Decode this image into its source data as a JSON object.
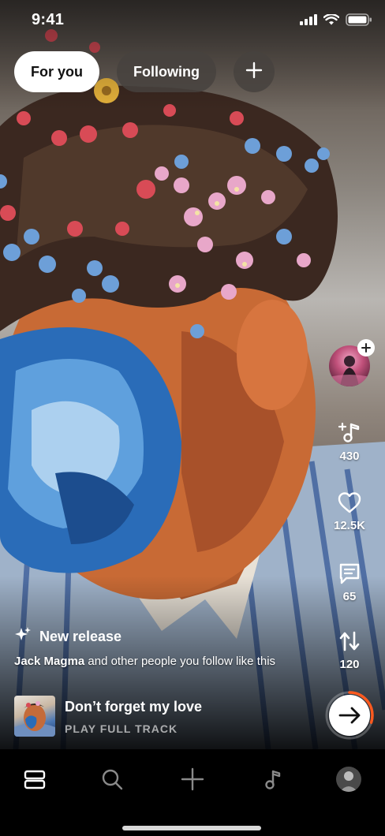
{
  "status_bar": {
    "time": "9:41"
  },
  "tabs": {
    "for_you": "For you",
    "following": "Following",
    "add_icon": "plus-icon"
  },
  "rail": {
    "avatar_icon": "artist-avatar",
    "add_track": {
      "icon": "music-plus-icon",
      "count": "430"
    },
    "like": {
      "icon": "heart-icon",
      "count": "12.5K"
    },
    "comment": {
      "icon": "comment-icon",
      "count": "65"
    },
    "repost": {
      "icon": "repost-icon",
      "count": "120"
    }
  },
  "caption": {
    "release_label": "New release",
    "follower_name": "Jack Magma",
    "follower_text": " and other people you follow like this"
  },
  "track": {
    "title": "Don’t forget my love",
    "subtitle": "PLAY FULL TRACK"
  },
  "progress": {
    "fraction": 0.3,
    "color": "#ff5a1f"
  },
  "nav": [
    "feed-icon",
    "search-icon",
    "upload-icon",
    "library-icon",
    "profile-avatar"
  ]
}
